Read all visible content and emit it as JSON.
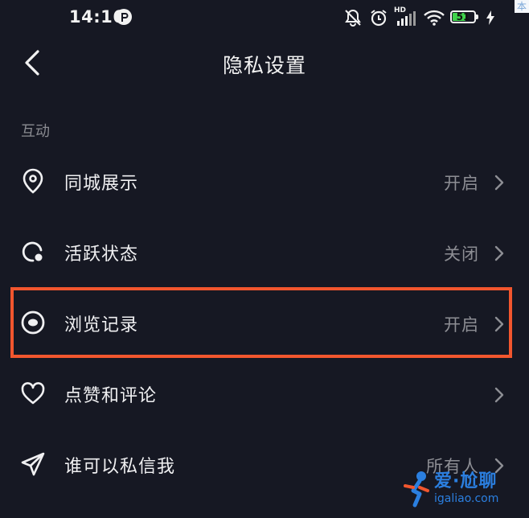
{
  "status_bar": {
    "time": "14:16",
    "battery_level": "51",
    "network_badge": "HD",
    "icons": [
      "mute-bell-icon",
      "alarm-icon",
      "hd-signal-icon",
      "wifi-icon",
      "battery-icon",
      "charging-icon"
    ],
    "corner_text": "本"
  },
  "header": {
    "title": "隐私设置",
    "back_icon": "chevron-left-icon"
  },
  "section": {
    "title": "互动"
  },
  "menu": [
    {
      "label": "同城展示",
      "value": "开启",
      "icon": "location-pin-icon"
    },
    {
      "label": "活跃状态",
      "value": "关闭",
      "icon": "activity-status-icon"
    },
    {
      "label": "浏览记录",
      "value": "开启",
      "icon": "eye-icon",
      "highlighted": true
    },
    {
      "label": "点赞和评论",
      "value": "",
      "icon": "heart-icon"
    },
    {
      "label": "谁可以私信我",
      "value": "所有人",
      "icon": "send-icon"
    }
  ],
  "colors": {
    "background": "#161823",
    "highlight": "#f2562e",
    "battery": "#3fd34b",
    "watermark": "#2b7fe0"
  },
  "watermark": {
    "text": "爱·尬聊",
    "url": "igaliao.com"
  }
}
